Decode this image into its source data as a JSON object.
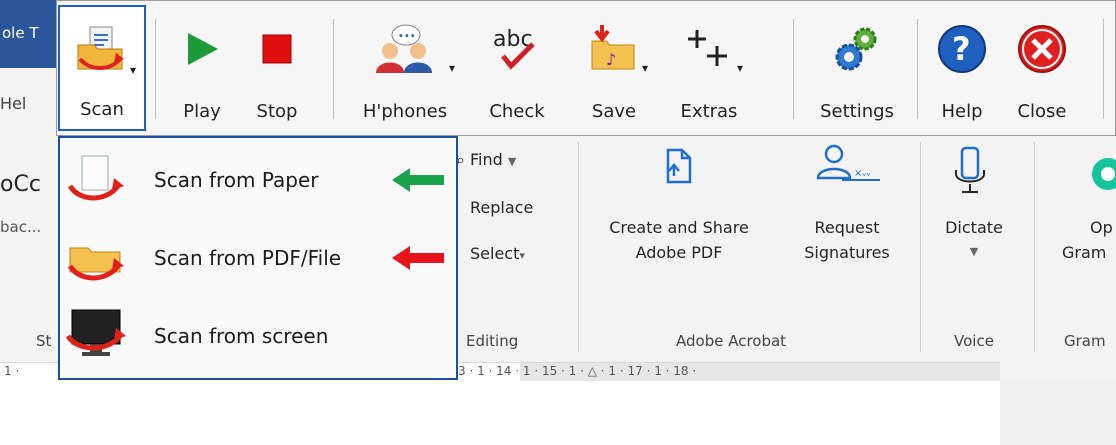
{
  "word": {
    "title_fragment": "ole T",
    "help_tab": "Hel",
    "styles_fragment_top": "oCc",
    "styles_fragment_sub": "bac...",
    "styles_group_fragment": "St",
    "editing": {
      "find_label": "Find",
      "replace_label": "Replace",
      "select_label": "Select",
      "group_label": "Editing"
    },
    "acrobat": {
      "create_share_label_line1": "Create and Share",
      "create_share_label_line2": "Adobe PDF",
      "request_sig_line1": "Request",
      "request_sig_line2": "Signatures",
      "group_label": "Adobe Acrobat"
    },
    "voice": {
      "dictate_label": "Dictate",
      "group_label": "Voice"
    },
    "grammarly": {
      "open_line1": "Op",
      "open_line2": "Gram",
      "group_label": "Gram"
    },
    "ruler_text": "3 · 1 · 14 · 1 · 15 · 1 · △ · 1 · 17 · 1 · 18 ·",
    "ruler_left": "1 ·"
  },
  "toolbar": {
    "buttons": [
      {
        "label": "Scan",
        "icon": "scan-folder-icon"
      },
      {
        "label": "Play",
        "icon": "play-icon"
      },
      {
        "label": "Stop",
        "icon": "stop-icon"
      },
      {
        "label": "H'phones",
        "icon": "headphones-people-icon"
      },
      {
        "label": "Check",
        "icon": "spellcheck-icon"
      },
      {
        "label": "Save",
        "icon": "save-folder-icon"
      },
      {
        "label": "Extras",
        "icon": "extras-plus-icon"
      },
      {
        "label": "Settings",
        "icon": "gears-icon"
      },
      {
        "label": "Help",
        "icon": "help-icon"
      },
      {
        "label": "Close",
        "icon": "close-icon"
      }
    ],
    "abc_text": "abc"
  },
  "scan_menu": {
    "items": [
      {
        "label": "Scan from Paper",
        "icon": "scan-paper-icon",
        "arrow_color": "#1aa34a"
      },
      {
        "label": "Scan from PDF/File",
        "icon": "scan-file-icon",
        "arrow_color": "#e8141c"
      },
      {
        "label": "Scan from screen",
        "icon": "scan-screen-icon"
      }
    ]
  },
  "colors": {
    "accent": "#1f5fbf",
    "play": "#1f9a3a",
    "stop": "#e01010",
    "help": "#1f5fbf",
    "close": "#e02020"
  }
}
